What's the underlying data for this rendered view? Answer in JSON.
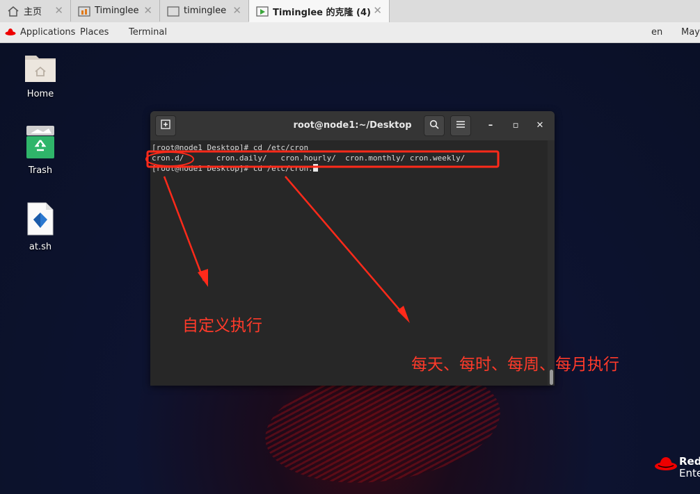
{
  "tabs": [
    {
      "label": "主页",
      "icon": "home-icon"
    },
    {
      "label": "Timinglee",
      "icon": "vm-icon"
    },
    {
      "label": "timinglee",
      "icon": "vm-icon"
    },
    {
      "label": "Timinglee 的克隆 (4)",
      "icon": "vm-running-icon",
      "active": true
    }
  ],
  "topbar": {
    "applications": "Applications",
    "places": "Places",
    "terminal": "Terminal",
    "lang": "en",
    "date": "May"
  },
  "desktop_icons": [
    {
      "label": "Home",
      "icon": "folder-home-icon"
    },
    {
      "label": "Trash",
      "icon": "trash-icon"
    },
    {
      "label": "at.sh",
      "icon": "script-file-icon"
    }
  ],
  "terminal": {
    "title": "root@node1:~/Desktop",
    "lines": [
      "[root@node1 Desktop]# cd /etc/cron",
      "cron.d/       cron.daily/   cron.hourly/  cron.monthly/ cron.weekly/",
      "[root@node1 Desktop]# cd /etc/cron."
    ]
  },
  "annotations": {
    "custom": "自定义执行",
    "periodic": "每天、每时、每周、每月执行"
  },
  "brand": {
    "line1": "Red",
    "line2": "Ente"
  },
  "colors": {
    "accent_red": "#ff2a1a",
    "terminal_bg": "#272727"
  }
}
